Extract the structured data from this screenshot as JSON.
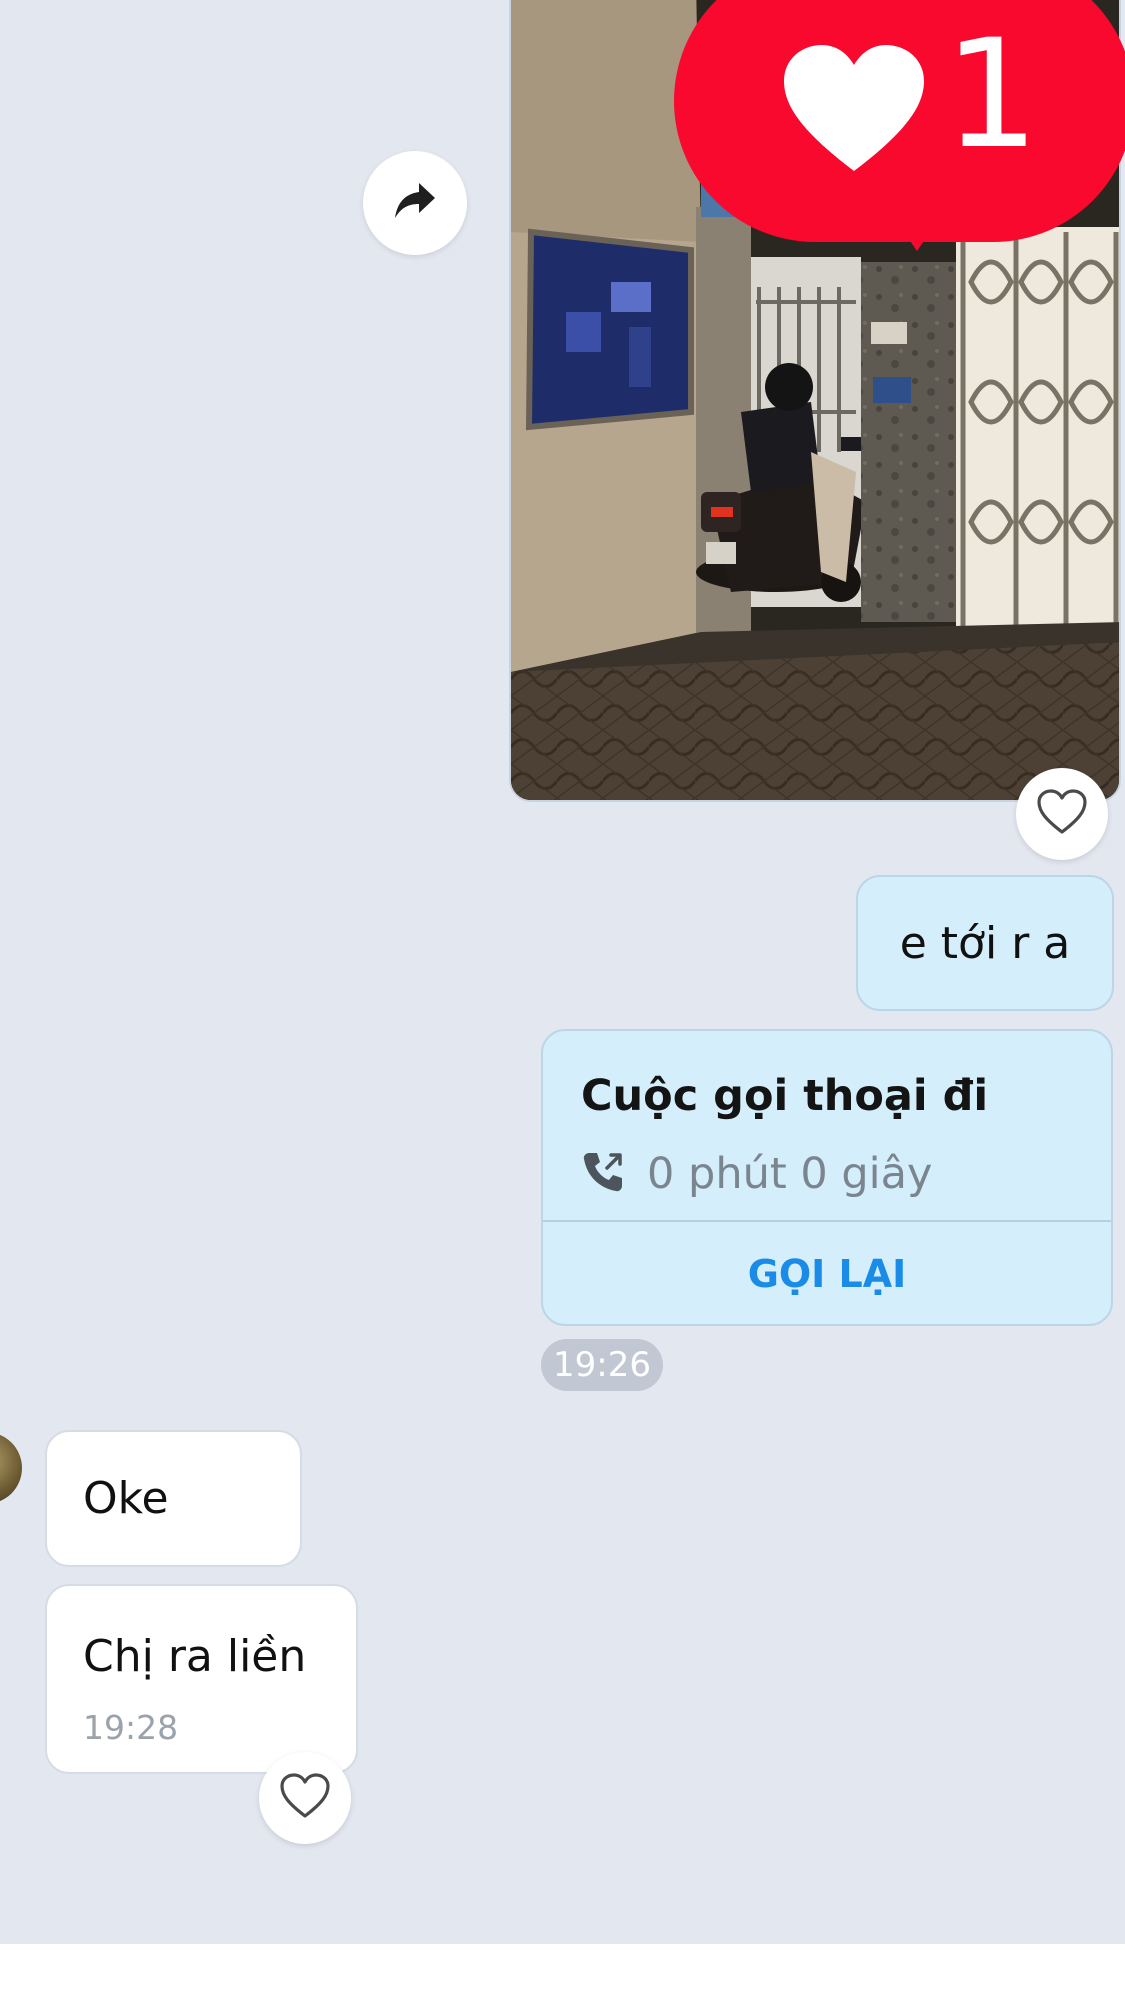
{
  "chat": {
    "photo_reaction": {
      "icon": "heart-icon",
      "count": "1",
      "color": "#f8092d"
    },
    "outgoing_messages": [
      {
        "text": "e tới r a"
      }
    ],
    "call_card": {
      "title": "Cuộc gọi thoại đi",
      "icon": "outgoing-call-icon",
      "duration": "0 phút 0 giây",
      "action_label": "GỌI LẠI",
      "time": "19:26"
    },
    "incoming_messages": [
      {
        "text": "Oke"
      },
      {
        "text": "Chị ra liền",
        "time": "19:28"
      }
    ]
  },
  "colors": {
    "chat_background": "#e3e7f0",
    "outgoing_bubble": "#d4eefb",
    "incoming_bubble": "#ffffff",
    "accent_blue": "#1a8ce8"
  }
}
